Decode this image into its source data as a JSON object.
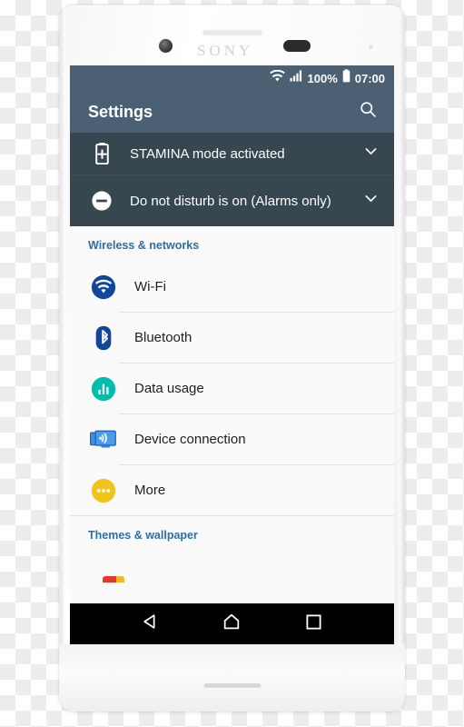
{
  "device": {
    "brand_logo": "SONY",
    "hardware": {
      "earpiece": "earpiece-speaker",
      "front_camera": "front-camera",
      "proximity_sensor": "proximity-sensor",
      "notification_led": "notification-led",
      "bottom_speaker": "bottom-speaker"
    }
  },
  "status_bar": {
    "wifi_icon": "wifi-icon",
    "signal_icon": "cellular-signal-icon",
    "battery_percent": "100%",
    "battery_icon": "battery-full-icon",
    "time": "07:00"
  },
  "app_bar": {
    "title": "Settings",
    "search_icon": "search-icon"
  },
  "notifications": [
    {
      "icon": "battery-stamina-icon",
      "label": "STAMINA mode activated",
      "expander_icon": "chevron-down-icon"
    },
    {
      "icon": "do-not-disturb-icon",
      "label": "Do not disturb is on (Alarms only)",
      "expander_icon": "chevron-down-icon"
    }
  ],
  "sections": [
    {
      "header": "Wireless & networks",
      "items": [
        {
          "label": "Wi-Fi",
          "icon": "wifi-icon",
          "icon_color": "#11479a"
        },
        {
          "label": "Bluetooth",
          "icon": "bluetooth-icon",
          "icon_color": "#11479a"
        },
        {
          "label": "Data usage",
          "icon": "data-usage-icon",
          "icon_color": "#00bcad"
        },
        {
          "label": "Device connection",
          "icon": "device-connection-icon",
          "icon_color": "#2f7fd8"
        },
        {
          "label": "More",
          "icon": "more-icon",
          "icon_color": "#f0c419"
        }
      ]
    },
    {
      "header": "Themes & wallpaper",
      "items": []
    }
  ],
  "nav_bar": {
    "back_icon": "back-triangle-icon",
    "home_icon": "home-icon",
    "recents_icon": "recents-square-icon"
  },
  "colors": {
    "app_bar": "#4b6072",
    "notification_bg": "#37474f",
    "section_header": "#2d6ea6",
    "list_bg": "#fafafa",
    "nav_bar": "#000000"
  }
}
